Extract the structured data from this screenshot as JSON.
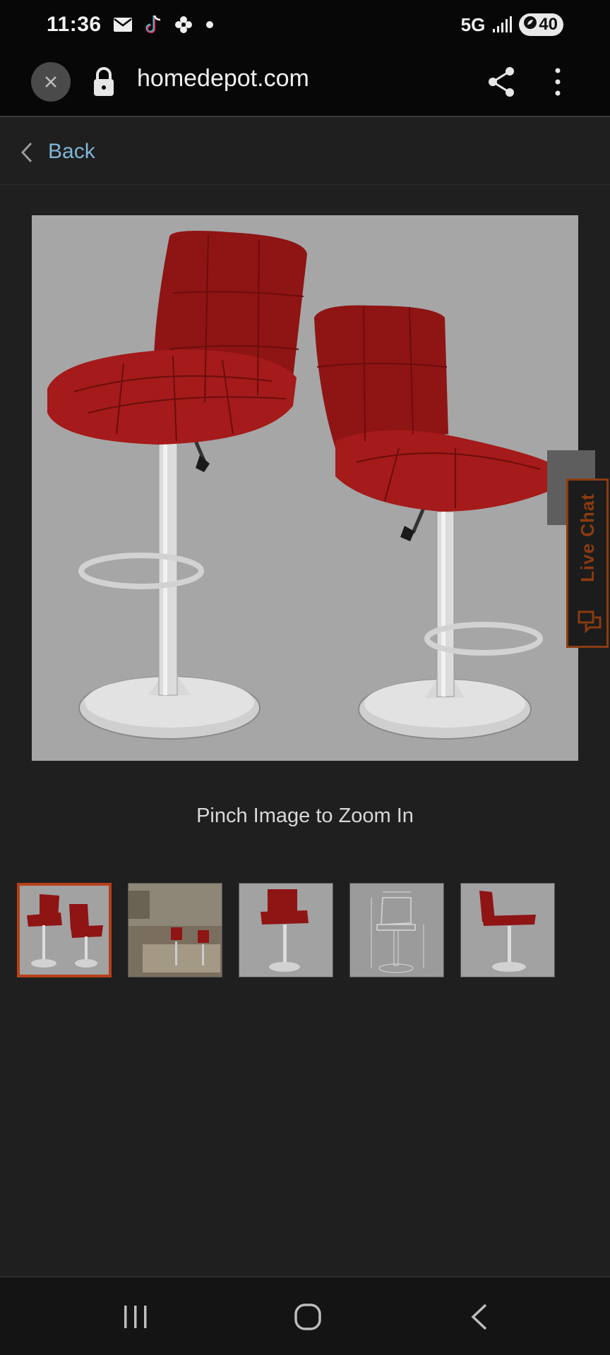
{
  "status_bar": {
    "time": "11:36",
    "network": "5G",
    "battery": "40",
    "icons": [
      "mail-icon",
      "tiktok-icon",
      "pinwheel-icon",
      "dot-icon",
      "signal-icon",
      "battery-saver-icon"
    ]
  },
  "browser": {
    "url": "homedepot.com",
    "icons": [
      "close-icon",
      "lock-icon",
      "share-icon",
      "more-vert-icon"
    ]
  },
  "page": {
    "back_label": "Back",
    "zoom_hint": "Pinch Image to Zoom In",
    "live_chat_label": "Live Chat"
  },
  "gallery": {
    "selected_index": 0,
    "thumbnails": [
      {
        "kind": "two-red-barstools"
      },
      {
        "kind": "barstools-in-kitchen"
      },
      {
        "kind": "single-red-barstool-front"
      },
      {
        "kind": "barstool-dimension-diagram"
      },
      {
        "kind": "single-red-barstool-side"
      }
    ]
  },
  "colors": {
    "background": "#1f1f1f",
    "accent_link": "#7fb6d8",
    "selected_border": "#b8401a",
    "stool_red": "#8f1414",
    "live_chat_accent": "#8a3b10"
  },
  "nav_bar": {
    "icons": [
      "recents-icon",
      "home-icon",
      "back-nav-icon"
    ]
  }
}
